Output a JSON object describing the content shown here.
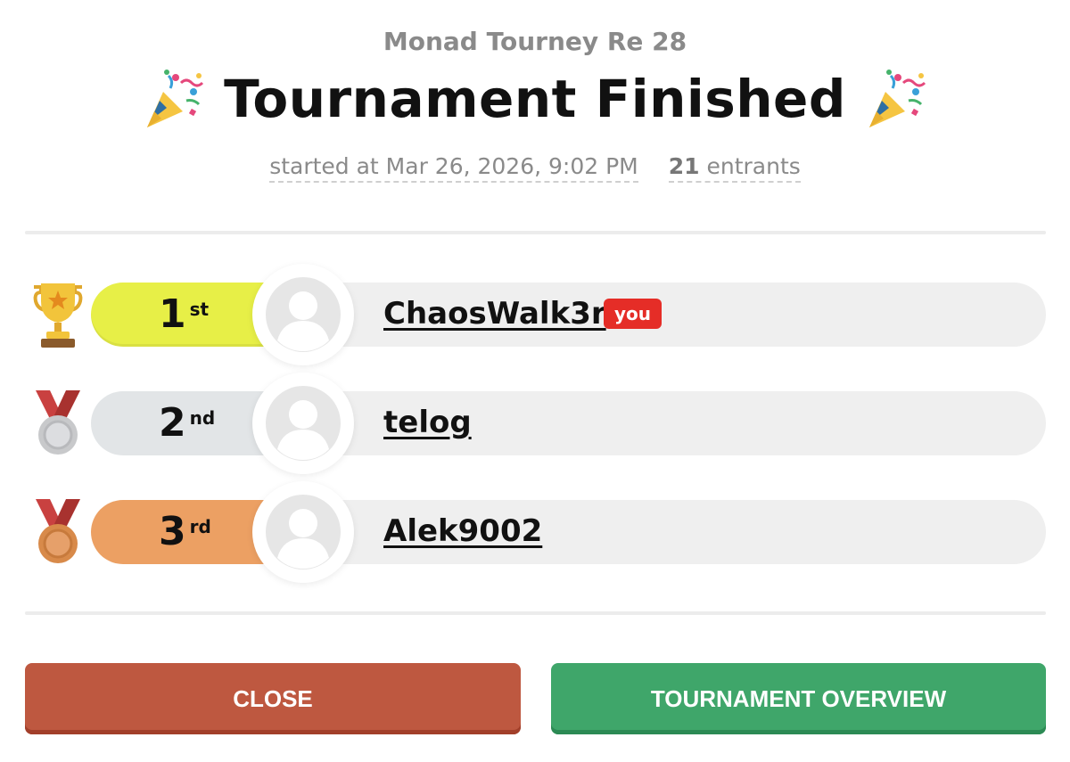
{
  "header": {
    "tournament_name": "Monad Tourney Re 28",
    "title": "Tournament Finished",
    "started_at": "started at Mar 26, 2026, 9:02 PM",
    "entrants_count": "21",
    "entrants_label": "entrants",
    "decoration_icon": "party-popper-icon"
  },
  "standings": [
    {
      "rank": "1",
      "suffix": "st",
      "name": "ChaosWalk3r",
      "badge": "you",
      "award_icon": "trophy-icon",
      "pill_color": "#e7ef47"
    },
    {
      "rank": "2",
      "suffix": "nd",
      "name": "telog",
      "award_icon": "silver-medal-icon",
      "pill_color": "#e2e5e7"
    },
    {
      "rank": "3",
      "suffix": "rd",
      "name": "Alek9002",
      "award_icon": "bronze-medal-icon",
      "pill_color": "#eca063"
    }
  ],
  "buttons": {
    "close_label": "CLOSE",
    "overview_label": "TOURNAMENT OVERVIEW",
    "close_color": "#be5840",
    "overview_color": "#3fa66a"
  },
  "colors": {
    "badge_red": "#e52d27",
    "track_gray": "#efefef"
  }
}
